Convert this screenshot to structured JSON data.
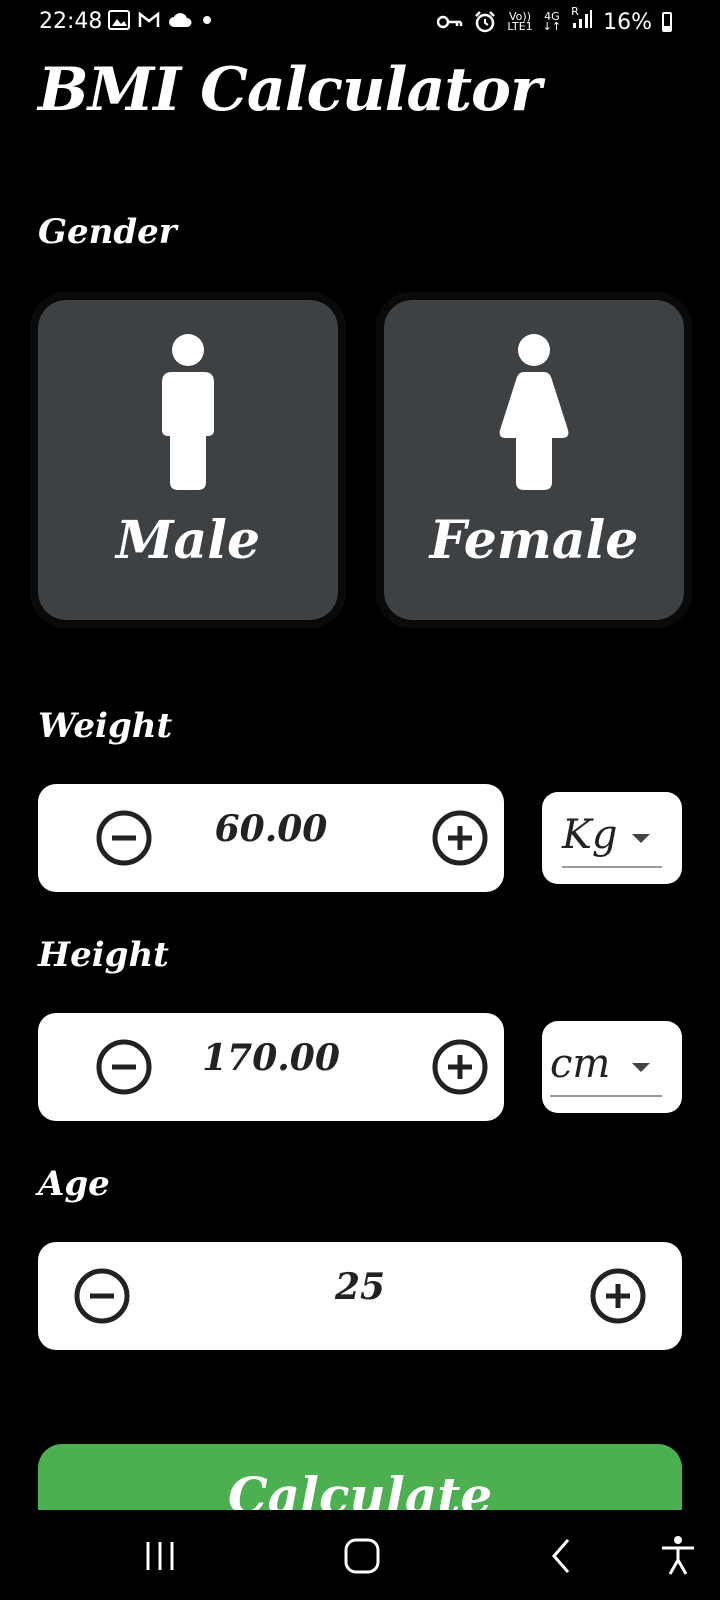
{
  "status": {
    "time": "22:48",
    "net_top": "Vo))",
    "net_bottom": "LTE1",
    "gen": "4G",
    "roam": "R",
    "battery": "16%"
  },
  "app": {
    "title": "BMI Calculator"
  },
  "gender": {
    "label": "Gender",
    "male": "Male",
    "female": "Female"
  },
  "weight": {
    "label": "Weight",
    "value": "60.00",
    "unit": "Kg"
  },
  "height": {
    "label": "Height",
    "value": "170.00",
    "unit": "cm"
  },
  "age": {
    "label": "Age",
    "value": "25"
  },
  "actions": {
    "calculate": "Calculate"
  },
  "colors": {
    "card_bg": "#3d4144",
    "accent": "#4caf50",
    "background": "#000000"
  }
}
